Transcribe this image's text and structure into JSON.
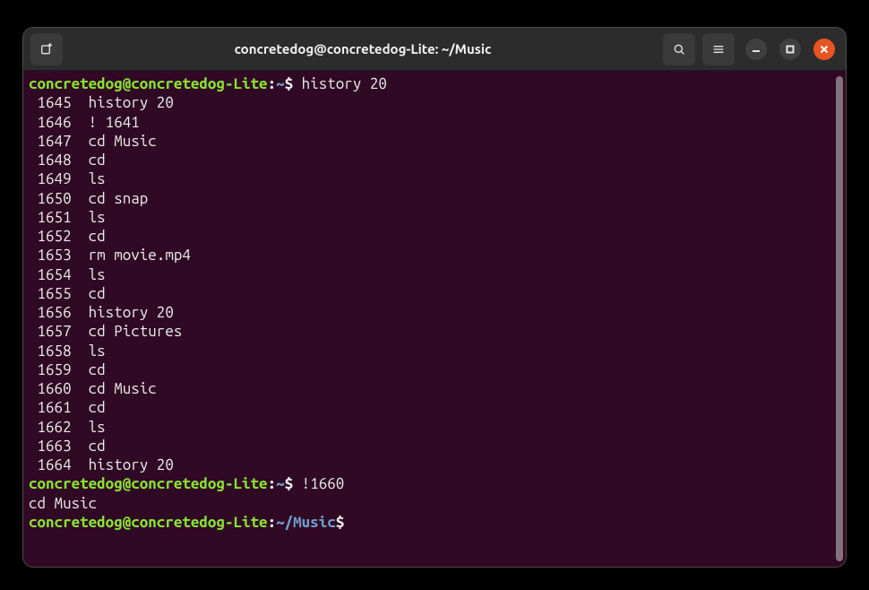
{
  "titlebar": {
    "title": "concretedog@concretedog-Lite: ~/Music"
  },
  "icons": {
    "new_tab": "new-tab-icon",
    "search": "search-icon",
    "menu": "hamburger-icon",
    "minimize": "minimize-icon",
    "maximize": "maximize-icon",
    "close": "close-icon"
  },
  "prompt1": {
    "user_host": "concretedog@concretedog-Lite",
    "colon": ":",
    "path": "~",
    "dollar": "$ ",
    "command": "history 20"
  },
  "history": [
    {
      "n": " 1645",
      "c": "history 20"
    },
    {
      "n": " 1646",
      "c": "! 1641"
    },
    {
      "n": " 1647",
      "c": "cd Music"
    },
    {
      "n": " 1648",
      "c": "cd"
    },
    {
      "n": " 1649",
      "c": "ls"
    },
    {
      "n": " 1650",
      "c": "cd snap"
    },
    {
      "n": " 1651",
      "c": "ls"
    },
    {
      "n": " 1652",
      "c": "cd"
    },
    {
      "n": " 1653",
      "c": "rm movie.mp4"
    },
    {
      "n": " 1654",
      "c": "ls"
    },
    {
      "n": " 1655",
      "c": "cd"
    },
    {
      "n": " 1656",
      "c": "history 20"
    },
    {
      "n": " 1657",
      "c": "cd Pictures"
    },
    {
      "n": " 1658",
      "c": "ls"
    },
    {
      "n": " 1659",
      "c": "cd"
    },
    {
      "n": " 1660",
      "c": "cd Music"
    },
    {
      "n": " 1661",
      "c": "cd"
    },
    {
      "n": " 1662",
      "c": "ls"
    },
    {
      "n": " 1663",
      "c": "cd"
    },
    {
      "n": " 1664",
      "c": "history 20"
    }
  ],
  "prompt2": {
    "user_host": "concretedog@concretedog-Lite",
    "colon": ":",
    "path": "~",
    "dollar": "$ ",
    "command": "!1660"
  },
  "echoed": "cd Music",
  "prompt3": {
    "user_host": "concretedog@concretedog-Lite",
    "colon": ":",
    "path": "~/Music",
    "dollar": "$ ",
    "command": ""
  }
}
